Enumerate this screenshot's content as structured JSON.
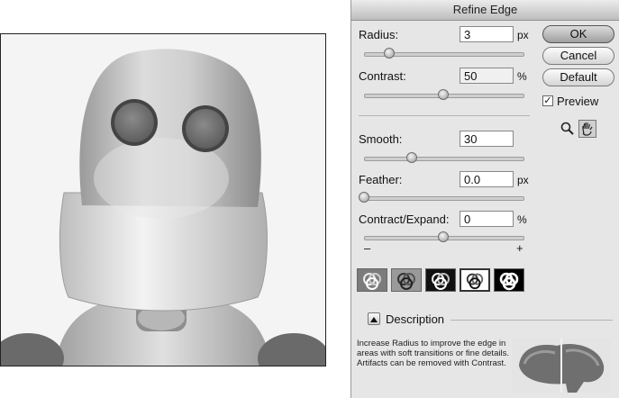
{
  "dialog": {
    "title": "Refine Edge",
    "radius": {
      "label": "Radius:",
      "value": "3",
      "unit": "px",
      "fraction": 0.16
    },
    "contrast": {
      "label": "Contrast:",
      "value": "50",
      "unit": "%",
      "fraction": 0.5
    },
    "smooth": {
      "label": "Smooth:",
      "value": "30",
      "fraction": 0.3
    },
    "feather": {
      "label": "Feather:",
      "value": "0.0",
      "unit": "px",
      "fraction": 0.0
    },
    "contract_expand": {
      "label": "Contract/Expand:",
      "value": "0",
      "unit": "%",
      "fraction": 0.5,
      "minus": "–",
      "plus": "+"
    },
    "buttons": {
      "ok": "OK",
      "cancel": "Cancel",
      "default": "Default"
    },
    "preview": {
      "label": "Preview",
      "checked": true,
      "mark": "✓"
    },
    "tools": [
      "zoom-tool",
      "hand-tool"
    ],
    "view_modes": [
      "standard",
      "quick-mask",
      "on-black",
      "on-white",
      "mask"
    ],
    "selected_view": 3,
    "description": {
      "label": "Description",
      "text": "Increase Radius to improve the edge in areas with soft transitions or fine details. Artifacts can be removed with Contrast."
    }
  }
}
